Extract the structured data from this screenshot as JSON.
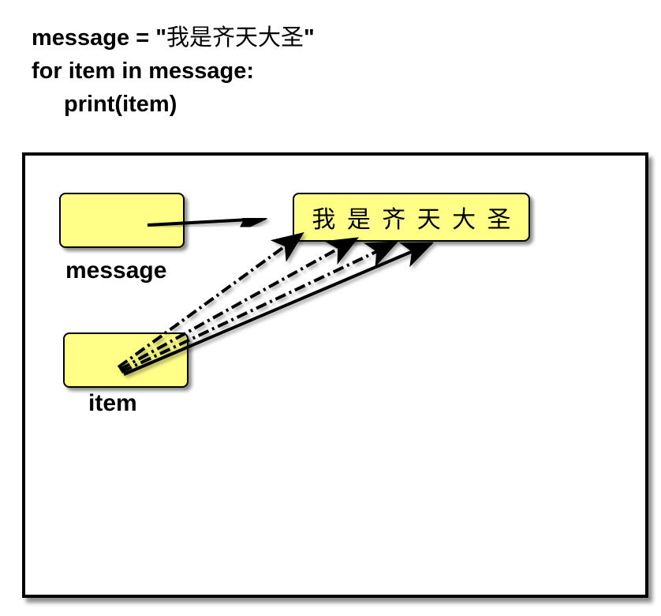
{
  "code": {
    "line1_prefix": "message = \"",
    "line1_string": "我是齐天大圣",
    "line1_suffix": "\"",
    "line2": "for item in message:",
    "line3": "print(item)"
  },
  "diagram": {
    "variables": {
      "message": "message",
      "item": "item"
    },
    "string_chars": [
      "我",
      "是",
      "齐",
      "天",
      "大",
      "圣"
    ]
  }
}
